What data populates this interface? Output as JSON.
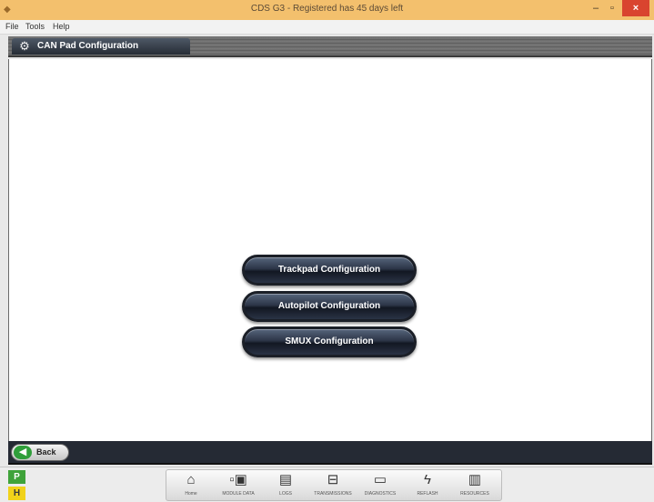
{
  "window": {
    "title": "CDS G3 - Registered has 45 days left",
    "app_icon": "app-logo-icon",
    "controls": {
      "minimize": "–",
      "maximize": "▫",
      "close": "×"
    }
  },
  "menu": {
    "items": [
      "File",
      "Tools",
      "Help"
    ]
  },
  "header": {
    "icon": "gear-icon",
    "title": "CAN Pad Configuration"
  },
  "buttons": {
    "trackpad": "Trackpad Configuration",
    "autopilot": "Autopilot Configuration",
    "smux": "SMUX Configuration"
  },
  "nav": {
    "back_label": "Back"
  },
  "modes": {
    "p": "P",
    "h": "H"
  },
  "dock": {
    "items": [
      {
        "icon": "home-icon",
        "label": "Home"
      },
      {
        "icon": "module-data-icon",
        "label": "MODULE DATA"
      },
      {
        "icon": "logs-icon",
        "label": "LOGS"
      },
      {
        "icon": "transmissions-icon",
        "label": "TRANSMISSIONS"
      },
      {
        "icon": "diagnostics-icon",
        "label": "DIAGNOSTICS"
      },
      {
        "icon": "reflash-icon",
        "label": "REFLASH"
      },
      {
        "icon": "resources-icon",
        "label": "RESOURCES"
      }
    ]
  },
  "colors": {
    "titlebar": "#f3c06d",
    "close": "#d9442f",
    "mode_p": "#3fa33a",
    "mode_h": "#f1d21a",
    "back_arrow": "#2f9e3a"
  }
}
